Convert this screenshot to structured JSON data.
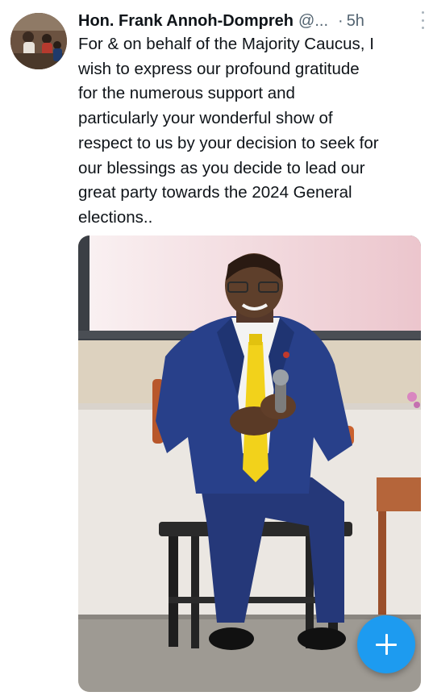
{
  "tweet": {
    "author_name": "Hon. Frank Annoh-Dompreh",
    "author_handle": "@...",
    "separator": "·",
    "time": "5h",
    "text": "For & on behalf of the Majority Caucus, I\nwish to express our profound gratitude\nfor the numerous support and\nparticularly your wonderful show of\nrespect to us by your decision to seek for\nour blessings as you decide to lead our\ngreat party towards the 2024 General\nelections.."
  },
  "icons": {
    "more": "more-vertical-icon",
    "compose": "plus-icon"
  },
  "colors": {
    "accent": "#1d9bf0",
    "text": "#0f1419",
    "muted": "#536471",
    "tie": "#f2d21b",
    "suit": "#263a7a"
  }
}
